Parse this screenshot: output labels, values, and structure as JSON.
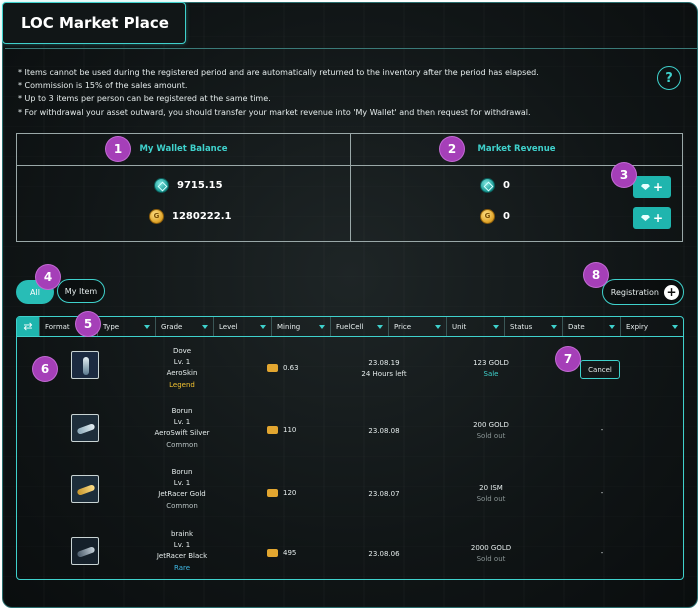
{
  "app": {
    "title": "LOC Market Place",
    "help_label": "?"
  },
  "notices": [
    "* Items cannot be used during the registered period and are automatically returned to the inventory after the period has elapsed.",
    "* Commission is 15% of the sales amount.",
    "* Up to 3 items per person can be registered at the same time.",
    "* For withdrawal your asset outward, you should transfer your market revenue into 'My Wallet' and then request for withdrawal."
  ],
  "wallet": {
    "title": "My Wallet Balance",
    "teal_amount": "9715.15",
    "gold_amount": "1280222.1"
  },
  "revenue": {
    "title": "Market Revenue",
    "teal_amount": "0",
    "gold_amount": "0",
    "transfer_label": "+"
  },
  "badges": [
    "1",
    "2",
    "3",
    "4",
    "5",
    "6",
    "7",
    "8"
  ],
  "filters": {
    "all_label": "All",
    "my_item_label": "My Item"
  },
  "registration_label": "Registration",
  "table": {
    "refresh_icon": "⇄",
    "columns": [
      "Format",
      "Type",
      "Grade",
      "Level",
      "Mining",
      "FuelCell",
      "Price",
      "Unit",
      "Status",
      "Date",
      "Expiry"
    ],
    "rows": [
      {
        "name": "Dove",
        "level": "Lv. 1",
        "type": "AeroSkin",
        "grade": "Legend",
        "mining": "0.63",
        "date": "23.08.19",
        "date_note": "24 Hours left",
        "price": "123 GOLD",
        "status": "Sale",
        "expiry": "",
        "action": "Cancel"
      },
      {
        "name": "Borun",
        "level": "Lv. 1",
        "type": "AeroSwift Silver",
        "grade": "Common",
        "mining": "110",
        "date": "23.08.08",
        "date_note": "",
        "price": "200 GOLD",
        "status": "Sold out",
        "expiry": "-",
        "action": ""
      },
      {
        "name": "Borun",
        "level": "Lv. 1",
        "type": "JetRacer Gold",
        "grade": "Common",
        "mining": "120",
        "date": "23.08.07",
        "date_note": "",
        "price": "20 ISM",
        "status": "Sold out",
        "expiry": "-",
        "action": ""
      },
      {
        "name": "braink",
        "level": "Lv. 1",
        "type": "JetRacer Black",
        "grade": "Rare",
        "mining": "495",
        "date": "23.08.06",
        "date_note": "",
        "price": "2000 GOLD",
        "status": "Sold out",
        "expiry": "-",
        "action": ""
      }
    ]
  },
  "colors": {
    "accent": "#3fd1cc",
    "badge": "#a53fb8",
    "legend": "#f2c230",
    "rare": "#3fb9e6"
  }
}
